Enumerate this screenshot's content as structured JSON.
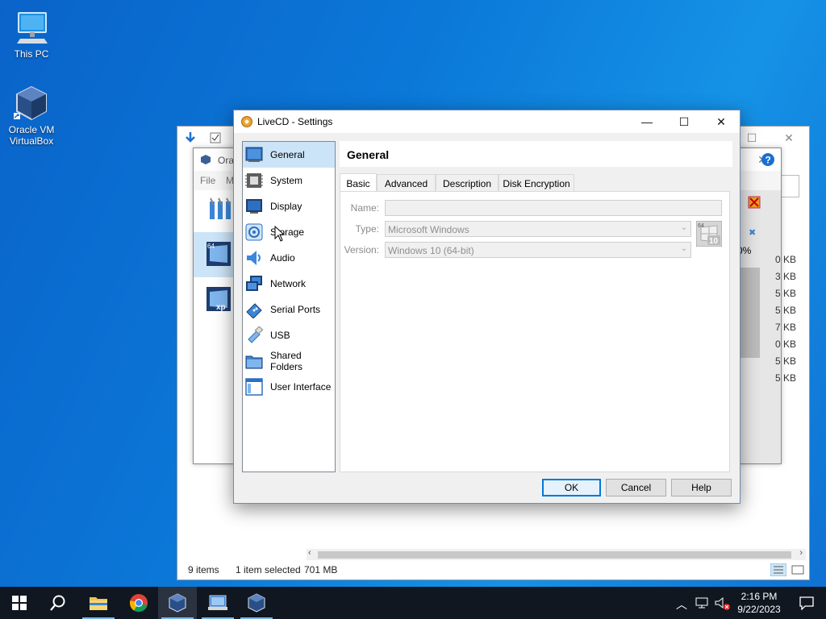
{
  "desktop": {
    "icons": [
      {
        "label": "This PC",
        "icon": "computer-icon"
      },
      {
        "label": "Oracle VM VirtualBox",
        "icon": "virtualbox-icon"
      }
    ]
  },
  "explorer": {
    "status_items": "9 items",
    "status_selected": "1 item selected",
    "status_size": "701 MB"
  },
  "vbmanager": {
    "title_fragment": "Ora",
    "menu_file": "File",
    "menu_more": "M",
    "progress": "0%",
    "sizes": [
      "0 KB",
      "3 KB",
      "5 KB",
      "5 KB",
      "7 KB",
      "0 KB",
      "5 KB",
      "5 KB"
    ]
  },
  "dialog": {
    "title": "LiveCD - Settings",
    "nav": [
      {
        "label": "General",
        "icon": "general-icon",
        "selected": true
      },
      {
        "label": "System",
        "icon": "system-icon"
      },
      {
        "label": "Display",
        "icon": "display-icon"
      },
      {
        "label": "Storage",
        "icon": "storage-icon"
      },
      {
        "label": "Audio",
        "icon": "audio-icon"
      },
      {
        "label": "Network",
        "icon": "network-icon"
      },
      {
        "label": "Serial Ports",
        "icon": "serial-ports-icon"
      },
      {
        "label": "USB",
        "icon": "usb-icon"
      },
      {
        "label": "Shared Folders",
        "icon": "shared-folders-icon"
      },
      {
        "label": "User Interface",
        "icon": "user-interface-icon"
      }
    ],
    "section_title": "General",
    "tabs": [
      "Basic",
      "Advanced",
      "Description",
      "Disk Encryption"
    ],
    "active_tab": "Basic",
    "form": {
      "name_label": "Name:",
      "name_value": "",
      "type_label": "Type:",
      "type_value": "Microsoft Windows",
      "version_label": "Version:",
      "version_value": "Windows 10 (64-bit)",
      "os_badge_top": "64",
      "os_badge_bottom": "10"
    },
    "buttons": {
      "ok": "OK",
      "cancel": "Cancel",
      "help": "Help"
    }
  },
  "taskbar": {
    "time": "2:16 PM",
    "date": "9/22/2023"
  }
}
